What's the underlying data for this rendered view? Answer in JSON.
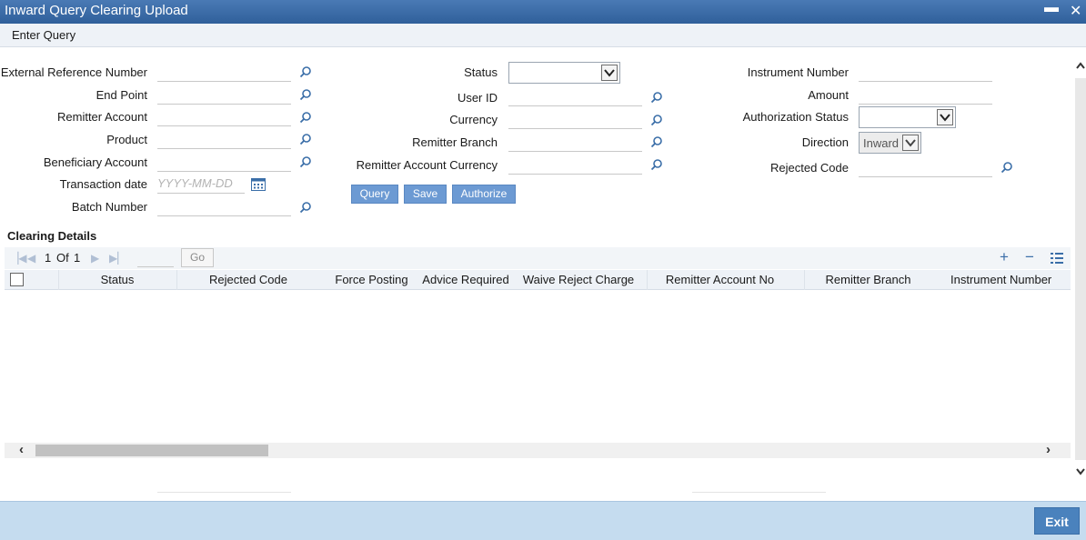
{
  "window": {
    "title": "Inward Query Clearing Upload",
    "minimize": "▬",
    "close": "✕"
  },
  "menu": {
    "enter_query": "Enter Query"
  },
  "form": {
    "external_reference_number": {
      "label": "External Reference Number",
      "value": ""
    },
    "end_point": {
      "label": "End Point",
      "value": ""
    },
    "remitter_account": {
      "label": "Remitter Account",
      "value": ""
    },
    "product": {
      "label": "Product",
      "value": ""
    },
    "beneficiary_account": {
      "label": "Beneficiary Account",
      "value": ""
    },
    "transaction_date": {
      "label": "Transaction date",
      "placeholder": "YYYY-MM-DD",
      "value": ""
    },
    "batch_number": {
      "label": "Batch Number",
      "value": ""
    },
    "status": {
      "label": "Status",
      "value": ""
    },
    "user_id": {
      "label": "User ID",
      "value": ""
    },
    "currency": {
      "label": "Currency",
      "value": ""
    },
    "remitter_branch": {
      "label": "Remitter Branch",
      "value": ""
    },
    "remitter_account_currency": {
      "label": "Remitter Account Currency",
      "value": ""
    },
    "instrument_number": {
      "label": "Instrument Number",
      "value": ""
    },
    "amount": {
      "label": "Amount",
      "value": ""
    },
    "authorization_status": {
      "label": "Authorization Status",
      "value": ""
    },
    "direction": {
      "label": "Direction",
      "value": "Inward"
    },
    "rejected_code": {
      "label": "Rejected Code",
      "value": ""
    }
  },
  "actions": {
    "query": "Query",
    "save": "Save",
    "authorize": "Authorize"
  },
  "clearing_details": {
    "title": "Clearing Details",
    "pager": {
      "current": "1",
      "of_label": "Of",
      "total": "1",
      "go": "Go"
    },
    "columns": [
      "Status",
      "Rejected Code",
      "Force Posting",
      "Advice Required",
      "Waive Reject Charge",
      "Remitter Account No",
      "Remitter Branch",
      "Instrument Number"
    ],
    "rows": []
  },
  "footer": {
    "exit": "Exit"
  },
  "colors": {
    "title_bar": "#2f5f9a",
    "button": "#6c9ad3",
    "footer": "#c5dcef",
    "exit_button": "#4a82bd"
  }
}
